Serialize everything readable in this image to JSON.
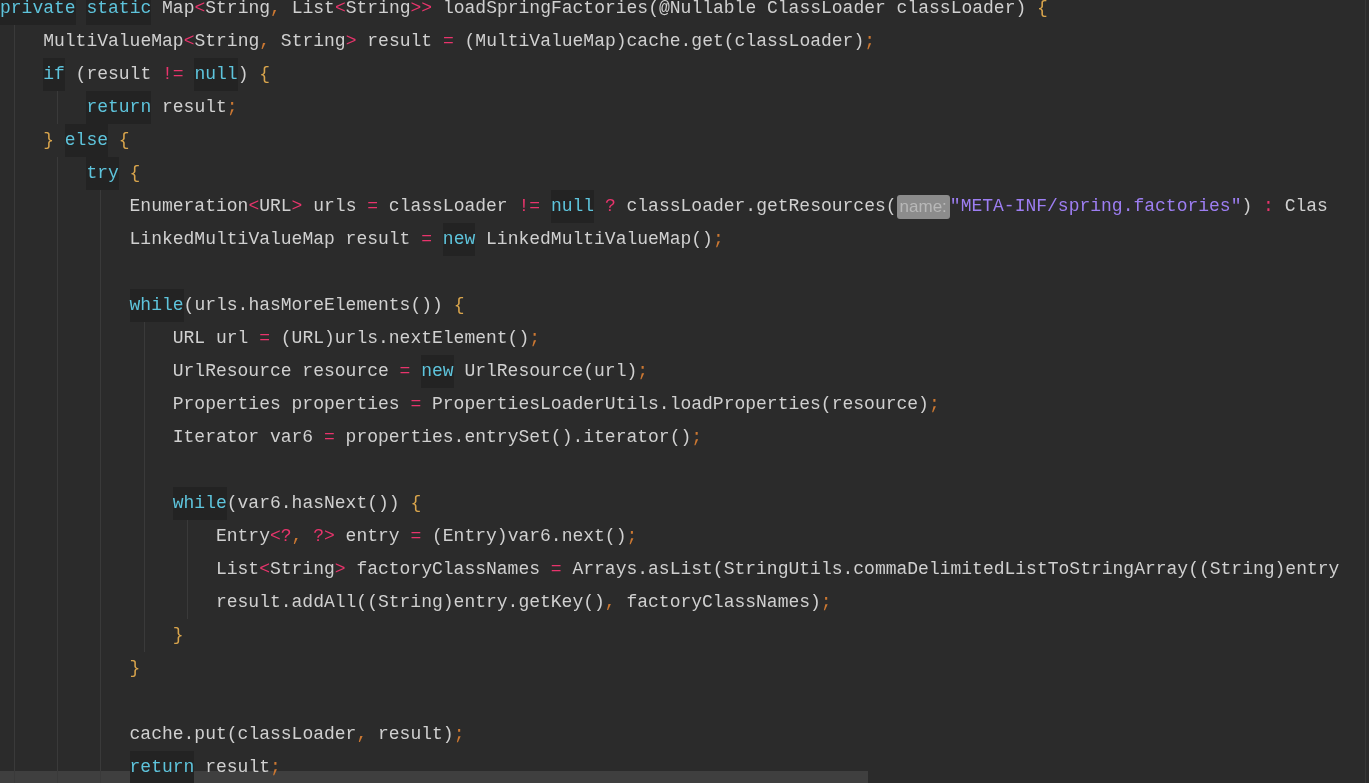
{
  "editor": {
    "lines": [
      {
        "kind": "code",
        "tokens": [
          {
            "kind": "kw",
            "text": "private"
          },
          {
            "kind": "space"
          },
          {
            "kind": "kw",
            "text": "static"
          },
          {
            "kind": "plain",
            "text": " Map"
          },
          {
            "kind": "op",
            "text": "<"
          },
          {
            "kind": "plain",
            "text": "String"
          },
          {
            "kind": "punct",
            "text": ","
          },
          {
            "kind": "plain",
            "text": " List"
          },
          {
            "kind": "op",
            "text": "<"
          },
          {
            "kind": "plain",
            "text": "String"
          },
          {
            "kind": "op",
            "text": ">>"
          },
          {
            "kind": "plain",
            "text": " loadSpringFactories(@Nullable ClassLoader classLoader) "
          },
          {
            "kind": "brace",
            "text": "{"
          }
        ],
        "children": [
          {
            "kind": "code",
            "tokens": [
              {
                "kind": "plain",
                "text": "MultiValueMap"
              },
              {
                "kind": "op",
                "text": "<"
              },
              {
                "kind": "plain",
                "text": "String"
              },
              {
                "kind": "punct",
                "text": ","
              },
              {
                "kind": "plain",
                "text": " String"
              },
              {
                "kind": "op",
                "text": ">"
              },
              {
                "kind": "plain",
                "text": " result "
              },
              {
                "kind": "op",
                "text": "="
              },
              {
                "kind": "plain",
                "text": " (MultiValueMap)cache.get(classLoader)"
              },
              {
                "kind": "punct",
                "text": ";"
              }
            ]
          },
          {
            "kind": "code",
            "tokens": [
              {
                "kind": "kw",
                "text": "if"
              },
              {
                "kind": "plain",
                "text": " (result "
              },
              {
                "kind": "op",
                "text": "!="
              },
              {
                "kind": "space"
              },
              {
                "kind": "kw",
                "text": "null"
              },
              {
                "kind": "plain",
                "text": ") "
              },
              {
                "kind": "brace",
                "text": "{"
              }
            ],
            "children": [
              {
                "kind": "code",
                "tokens": [
                  {
                    "kind": "kw",
                    "text": "return"
                  },
                  {
                    "kind": "plain",
                    "text": " result"
                  },
                  {
                    "kind": "punct",
                    "text": ";"
                  }
                ]
              }
            ]
          },
          {
            "kind": "code",
            "tokens": [
              {
                "kind": "brace",
                "text": "}"
              },
              {
                "kind": "space"
              },
              {
                "kind": "kw",
                "text": "else"
              },
              {
                "kind": "space"
              },
              {
                "kind": "brace",
                "text": "{"
              }
            ],
            "children": [
              {
                "kind": "code",
                "tokens": [
                  {
                    "kind": "kw",
                    "text": "try"
                  },
                  {
                    "kind": "space"
                  },
                  {
                    "kind": "brace",
                    "text": "{"
                  }
                ],
                "children": [
                  {
                    "kind": "code",
                    "tokens": [
                      {
                        "kind": "plain",
                        "text": "Enumeration"
                      },
                      {
                        "kind": "op",
                        "text": "<"
                      },
                      {
                        "kind": "plain",
                        "text": "URL"
                      },
                      {
                        "kind": "op",
                        "text": ">"
                      },
                      {
                        "kind": "plain",
                        "text": " urls "
                      },
                      {
                        "kind": "op",
                        "text": "="
                      },
                      {
                        "kind": "plain",
                        "text": " classLoader "
                      },
                      {
                        "kind": "op",
                        "text": "!="
                      },
                      {
                        "kind": "space"
                      },
                      {
                        "kind": "kw",
                        "text": "null"
                      },
                      {
                        "kind": "space"
                      },
                      {
                        "kind": "op",
                        "text": "?"
                      },
                      {
                        "kind": "plain",
                        "text": " classLoader.getResources("
                      },
                      {
                        "kind": "hint",
                        "text": "name:"
                      },
                      {
                        "kind": "str",
                        "text": "\"META-INF/spring.factories\""
                      },
                      {
                        "kind": "plain",
                        "text": ") "
                      },
                      {
                        "kind": "op",
                        "text": ":"
                      },
                      {
                        "kind": "plain",
                        "text": " Clas"
                      }
                    ]
                  },
                  {
                    "kind": "code",
                    "tokens": [
                      {
                        "kind": "plain",
                        "text": "LinkedMultiValueMap result "
                      },
                      {
                        "kind": "op",
                        "text": "="
                      },
                      {
                        "kind": "space"
                      },
                      {
                        "kind": "kw",
                        "text": "new"
                      },
                      {
                        "kind": "plain",
                        "text": " LinkedMultiValueMap()"
                      },
                      {
                        "kind": "punct",
                        "text": ";"
                      }
                    ]
                  },
                  {
                    "kind": "blank"
                  },
                  {
                    "kind": "code",
                    "tokens": [
                      {
                        "kind": "kw",
                        "text": "while"
                      },
                      {
                        "kind": "plain",
                        "text": "(urls.hasMoreElements()) "
                      },
                      {
                        "kind": "brace",
                        "text": "{"
                      }
                    ],
                    "children": [
                      {
                        "kind": "code",
                        "tokens": [
                          {
                            "kind": "plain",
                            "text": "URL url "
                          },
                          {
                            "kind": "op",
                            "text": "="
                          },
                          {
                            "kind": "plain",
                            "text": " (URL)urls.nextElement()"
                          },
                          {
                            "kind": "punct",
                            "text": ";"
                          }
                        ]
                      },
                      {
                        "kind": "code",
                        "tokens": [
                          {
                            "kind": "plain",
                            "text": "UrlResource resource "
                          },
                          {
                            "kind": "op",
                            "text": "="
                          },
                          {
                            "kind": "space"
                          },
                          {
                            "kind": "kw",
                            "text": "new"
                          },
                          {
                            "kind": "plain",
                            "text": " UrlResource(url)"
                          },
                          {
                            "kind": "punct",
                            "text": ";"
                          }
                        ]
                      },
                      {
                        "kind": "code",
                        "tokens": [
                          {
                            "kind": "plain",
                            "text": "Properties properties "
                          },
                          {
                            "kind": "op",
                            "text": "="
                          },
                          {
                            "kind": "plain",
                            "text": " PropertiesLoaderUtils.loadProperties(resource)"
                          },
                          {
                            "kind": "punct",
                            "text": ";"
                          }
                        ]
                      },
                      {
                        "kind": "code",
                        "tokens": [
                          {
                            "kind": "plain",
                            "text": "Iterator var6 "
                          },
                          {
                            "kind": "op",
                            "text": "="
                          },
                          {
                            "kind": "plain",
                            "text": " properties.entrySet().iterator()"
                          },
                          {
                            "kind": "punct",
                            "text": ";"
                          }
                        ]
                      },
                      {
                        "kind": "blank"
                      },
                      {
                        "kind": "code",
                        "tokens": [
                          {
                            "kind": "kw",
                            "text": "while"
                          },
                          {
                            "kind": "plain",
                            "text": "(var6.hasNext()) "
                          },
                          {
                            "kind": "brace",
                            "text": "{"
                          }
                        ],
                        "children": [
                          {
                            "kind": "code",
                            "tokens": [
                              {
                                "kind": "plain",
                                "text": "Entry"
                              },
                              {
                                "kind": "op",
                                "text": "<?"
                              },
                              {
                                "kind": "punct",
                                "text": ","
                              },
                              {
                                "kind": "space"
                              },
                              {
                                "kind": "op",
                                "text": "?>"
                              },
                              {
                                "kind": "plain",
                                "text": " entry "
                              },
                              {
                                "kind": "op",
                                "text": "="
                              },
                              {
                                "kind": "plain",
                                "text": " (Entry)var6.next()"
                              },
                              {
                                "kind": "punct",
                                "text": ";"
                              }
                            ]
                          },
                          {
                            "kind": "code",
                            "tokens": [
                              {
                                "kind": "plain",
                                "text": "List"
                              },
                              {
                                "kind": "op",
                                "text": "<"
                              },
                              {
                                "kind": "plain",
                                "text": "String"
                              },
                              {
                                "kind": "op",
                                "text": ">"
                              },
                              {
                                "kind": "plain",
                                "text": " factoryClassNames "
                              },
                              {
                                "kind": "op",
                                "text": "="
                              },
                              {
                                "kind": "plain",
                                "text": " Arrays.asList(StringUtils.commaDelimitedListToStringArray((String)entry"
                              }
                            ]
                          },
                          {
                            "kind": "code",
                            "tokens": [
                              {
                                "kind": "plain",
                                "text": "result.addAll((String)entry.getKey()"
                              },
                              {
                                "kind": "punct",
                                "text": ","
                              },
                              {
                                "kind": "plain",
                                "text": " factoryClassNames)"
                              },
                              {
                                "kind": "punct",
                                "text": ";"
                              }
                            ]
                          }
                        ]
                      },
                      {
                        "kind": "code",
                        "tokens": [
                          {
                            "kind": "brace",
                            "text": "}"
                          }
                        ]
                      }
                    ]
                  },
                  {
                    "kind": "code",
                    "tokens": [
                      {
                        "kind": "brace",
                        "text": "}"
                      }
                    ]
                  },
                  {
                    "kind": "blank"
                  },
                  {
                    "kind": "code",
                    "tokens": [
                      {
                        "kind": "plain",
                        "text": "cache.put(classLoader"
                      },
                      {
                        "kind": "punct",
                        "text": ","
                      },
                      {
                        "kind": "plain",
                        "text": " result)"
                      },
                      {
                        "kind": "punct",
                        "text": ";"
                      }
                    ]
                  },
                  {
                    "kind": "code",
                    "tokens": [
                      {
                        "kind": "kw",
                        "text": "return"
                      },
                      {
                        "kind": "plain",
                        "text": " result"
                      },
                      {
                        "kind": "punct",
                        "text": ";"
                      }
                    ]
                  }
                ]
              }
            ]
          }
        ]
      }
    ]
  }
}
